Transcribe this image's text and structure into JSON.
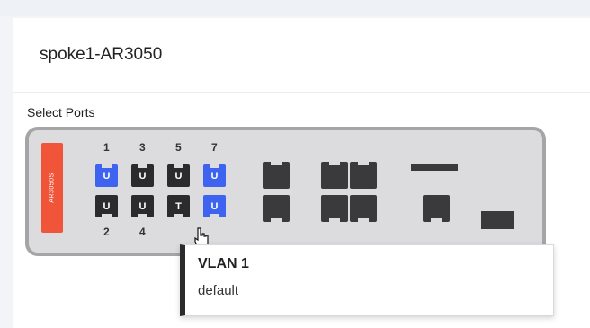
{
  "device": {
    "title": "spoke1-AR3050",
    "model_tag": "AR3050S",
    "select_label": "Select Ports",
    "top_port_numbers": [
      "1",
      "3",
      "5",
      "7"
    ],
    "bottom_port_numbers": [
      "2",
      "4"
    ],
    "top_ports": [
      {
        "label": "U",
        "color": "#3d63f0",
        "selected": true
      },
      {
        "label": "U",
        "color": "#2b2b2d",
        "selected": false
      },
      {
        "label": "U",
        "color": "#2b2b2d",
        "selected": false
      },
      {
        "label": "U",
        "color": "#3d63f0",
        "selected": true
      }
    ],
    "bottom_ports": [
      {
        "label": "U",
        "color": "#2b2b2d",
        "selected": false
      },
      {
        "label": "U",
        "color": "#2b2b2d",
        "selected": false
      },
      {
        "label": "T",
        "color": "#2b2b2d",
        "selected": false
      },
      {
        "label": "U",
        "color": "#3d63f0",
        "selected": true
      }
    ]
  },
  "tooltip": {
    "title": "VLAN 1",
    "subtitle": "default"
  },
  "colors": {
    "accent_blue": "#3d63f0",
    "model_tag": "#f0553a",
    "port_dark": "#2b2b2d"
  }
}
